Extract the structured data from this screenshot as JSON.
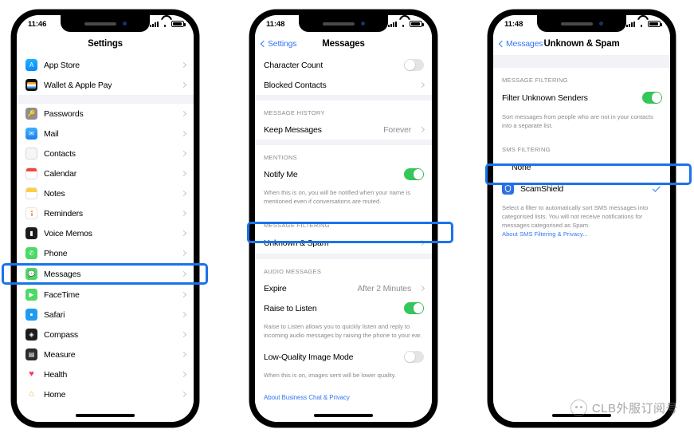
{
  "phones": [
    {
      "id": "settings-list",
      "status": {
        "time": "11:46",
        "signal_icon": "cellular-bars-icon",
        "wifi_icon": "wifi-icon",
        "battery_icon": "battery-icon"
      },
      "nav": {
        "title": "Settings",
        "back_label": null
      },
      "rows": [
        {
          "label": "App Store",
          "icon": "app-store-icon",
          "accessory": "chevron"
        },
        {
          "label": "Wallet & Apple Pay",
          "icon": "wallet-icon",
          "accessory": "chevron"
        },
        {
          "label": "Passwords",
          "icon": "passwords-icon",
          "accessory": "chevron"
        },
        {
          "label": "Mail",
          "icon": "mail-icon",
          "accessory": "chevron"
        },
        {
          "label": "Contacts",
          "icon": "contacts-icon",
          "accessory": "chevron"
        },
        {
          "label": "Calendar",
          "icon": "calendar-icon",
          "accessory": "chevron"
        },
        {
          "label": "Notes",
          "icon": "notes-icon",
          "accessory": "chevron"
        },
        {
          "label": "Reminders",
          "icon": "reminders-icon",
          "accessory": "chevron"
        },
        {
          "label": "Voice Memos",
          "icon": "voice-memos-icon",
          "accessory": "chevron"
        },
        {
          "label": "Phone",
          "icon": "phone-icon",
          "accessory": "chevron"
        },
        {
          "label": "Messages",
          "icon": "messages-icon",
          "accessory": "chevron",
          "highlighted": true
        },
        {
          "label": "FaceTime",
          "icon": "facetime-icon",
          "accessory": "chevron"
        },
        {
          "label": "Safari",
          "icon": "safari-icon",
          "accessory": "chevron"
        },
        {
          "label": "Compass",
          "icon": "compass-icon",
          "accessory": "chevron"
        },
        {
          "label": "Measure",
          "icon": "measure-icon",
          "accessory": "chevron"
        },
        {
          "label": "Health",
          "icon": "health-icon",
          "accessory": "chevron"
        },
        {
          "label": "Home",
          "icon": "home-icon",
          "accessory": "chevron"
        }
      ]
    },
    {
      "id": "messages-settings",
      "status": {
        "time": "11:48"
      },
      "nav": {
        "title": "Messages",
        "back_label": "Settings"
      },
      "rows": {
        "character_count": {
          "label": "Character Count",
          "toggle": "off"
        },
        "blocked_contacts": {
          "label": "Blocked Contacts",
          "accessory": "chevron"
        },
        "history_header": "MESSAGE HISTORY",
        "keep_messages": {
          "label": "Keep Messages",
          "value": "Forever",
          "accessory": "chevron"
        },
        "mentions_header": "MENTIONS",
        "notify_me": {
          "label": "Notify Me",
          "toggle": "on"
        },
        "notify_footnote": "When this is on, you will be notified when your name is mentioned even if conversations are muted.",
        "filtering_header": "MESSAGE FILTERING",
        "unknown_spam": {
          "label": "Unknown & Spam",
          "accessory": "chevron",
          "highlighted": true
        },
        "audio_header": "AUDIO MESSAGES",
        "expire": {
          "label": "Expire",
          "value": "After 2 Minutes",
          "accessory": "chevron"
        },
        "raise_to_listen": {
          "label": "Raise to Listen",
          "toggle": "on"
        },
        "raise_footnote": "Raise to Listen allows you to quickly listen and reply to incoming audio messages by raising the phone to your ear.",
        "low_quality": {
          "label": "Low-Quality Image Mode",
          "toggle": "off"
        },
        "low_quality_footnote": "When this is on, images sent will be lower quality.",
        "business_chat_link": "About Business Chat & Privacy"
      }
    },
    {
      "id": "unknown-and-spam",
      "status": {
        "time": "11:48"
      },
      "nav": {
        "title": "Unknown & Spam",
        "back_label": "Messages"
      },
      "rows": {
        "filtering_header": "MESSAGE FILTERING",
        "filter_unknown": {
          "label": "Filter Unknown Senders",
          "toggle": "on"
        },
        "filter_footnote": "Sort messages from people who are not in your contacts into a separate list.",
        "sms_header": "SMS FILTERING",
        "none": {
          "label": "None",
          "selected": false
        },
        "scamshield": {
          "label": "ScamShield",
          "icon": "scamshield-icon",
          "selected": true,
          "highlighted": true
        },
        "sms_footnote": "Select a filter to automatically sort SMS messages into categorised lists. You will not receive notifications for messages categorised as Spam.",
        "sms_link": "About SMS Filtering & Privacy..."
      }
    }
  ],
  "watermark": {
    "text": "CLB外服订阅号",
    "logo_icon": "cat-face-logo-icon"
  },
  "colors": {
    "accent_blue": "#3478f6",
    "highlight_blue": "#1a73e8",
    "toggle_green": "#34c759",
    "muted_gray": "#8e8e93"
  }
}
